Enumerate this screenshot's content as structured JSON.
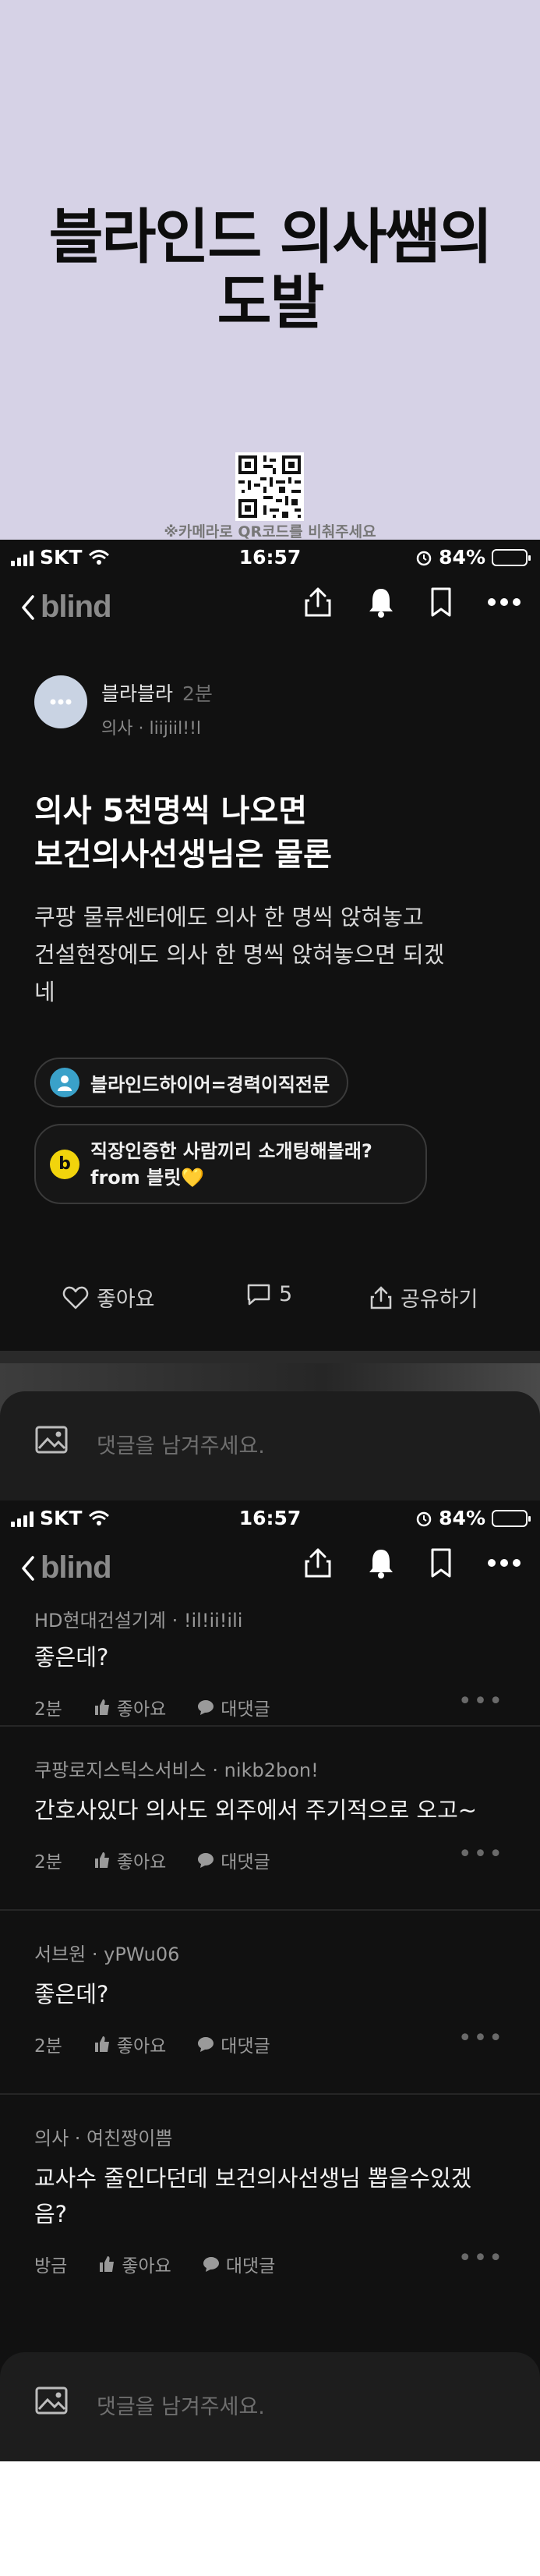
{
  "title_card": {
    "headline_line1": "블라인드 의사쌤의",
    "headline_line2": "도발",
    "qr_caption": "※카메라로 QR코드를 비춰주세요"
  },
  "status_bar": {
    "carrier": "SKT",
    "time": "16:57",
    "battery": "84%",
    "battery_level": 0.84
  },
  "nav": {
    "logo": "blind"
  },
  "post": {
    "author_name": "블라블라",
    "time_ago": "2분",
    "author_meta": "의사 · liijiil!!l",
    "title_line1": "의사 5천명씩 나오면",
    "title_line2": "보건의사선생님은 물론",
    "body_line1": "쿠팡 물류센터에도 의사 한 명씩 앉혀놓고",
    "body_line2": "건설현장에도 의사 한 명씩 앉혀놓으면 되겠",
    "body_line3": "네",
    "chip1_label": "블라인드하이어=경력이직전문",
    "chip2_line1": "직장인증한 사람끼리 소개팅해볼래?",
    "chip2_line2": "from 블릿💛",
    "like_label": "좋아요",
    "comment_count": "5",
    "share_label": "공유하기"
  },
  "composer": {
    "placeholder": "댓글을 남겨주세요."
  },
  "comments": [
    {
      "author": "HD현대건설기계 · !il!ii!ili",
      "text": "좋은데?",
      "time": "2분",
      "like": "좋아요",
      "reply": "대댓글"
    },
    {
      "author": "쿠팡로지스틱스서비스 · nikb2bon!",
      "text": "간호사있다 의사도 외주에서 주기적으로 오고~",
      "time": "2분",
      "like": "좋아요",
      "reply": "대댓글"
    },
    {
      "author": "서브원 · yPWu06",
      "text": "좋은데?",
      "time": "2분",
      "like": "좋아요",
      "reply": "대댓글"
    },
    {
      "author": "의사 · 여친짱이쁨",
      "text_line1": "교사수 줄인다던데 보건의사선생님 뽑을수있겠",
      "text_line2": "음?",
      "time": "방금",
      "like": "좋아요",
      "reply": "대댓글"
    }
  ],
  "colors": {
    "background": "#111111",
    "title_bg": "#d6d2e6",
    "hire_chip": "#3aa1c9",
    "blit_chip": "#f2d40c"
  }
}
